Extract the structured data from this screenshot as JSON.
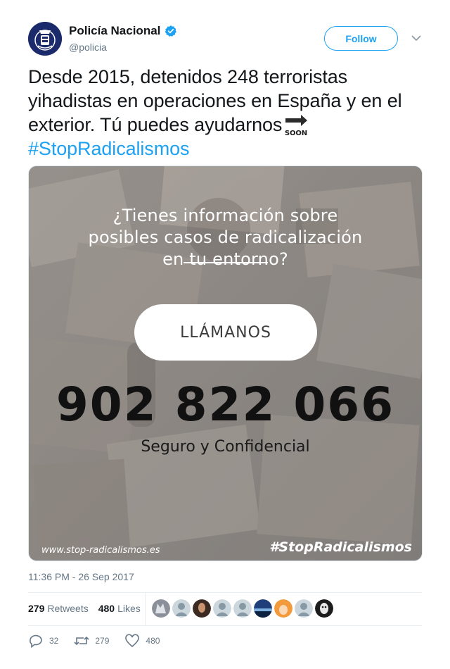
{
  "author": {
    "name": "Policía Nacional",
    "handle": "@policia",
    "verified": true,
    "avatar_icon": "police-shield-logo"
  },
  "header": {
    "follow_label": "Follow",
    "menu_icon": "chevron-down-icon"
  },
  "tweet": {
    "text": "Desde 2015, detenidos 248 terroristas yihadistas en operaciones en España y en el exterior. Tú puedes ayudarnos",
    "emoji": "soon-arrow-icon",
    "hashtag": "#StopRadicalismos",
    "timestamp": "11:36 PM - 26 Sep 2017"
  },
  "media": {
    "question": "¿Tienes información sobre posibles casos de radicalización en tu entorno?",
    "call_label": "LLÁMANOS",
    "phone": "902 822 066",
    "subtitle": "Seguro y Confidencial",
    "website": "www.stop-radicalismos.es",
    "hashtag": "#StopRadicalismos",
    "background_icon": "photo-collage"
  },
  "stats": {
    "retweets_count": "279",
    "retweets_label": "Retweets",
    "likes_count": "480",
    "likes_label": "Likes",
    "likers": [
      "wolf",
      "default",
      "woman",
      "default",
      "default",
      "landscape",
      "anime",
      "default",
      "masked"
    ]
  },
  "actions": {
    "replies": "32",
    "retweets": "279",
    "likes": "480"
  },
  "colors": {
    "accent": "#1da1f2",
    "text": "#14171a",
    "secondary": "#657786",
    "verified": "#1da1f2"
  }
}
